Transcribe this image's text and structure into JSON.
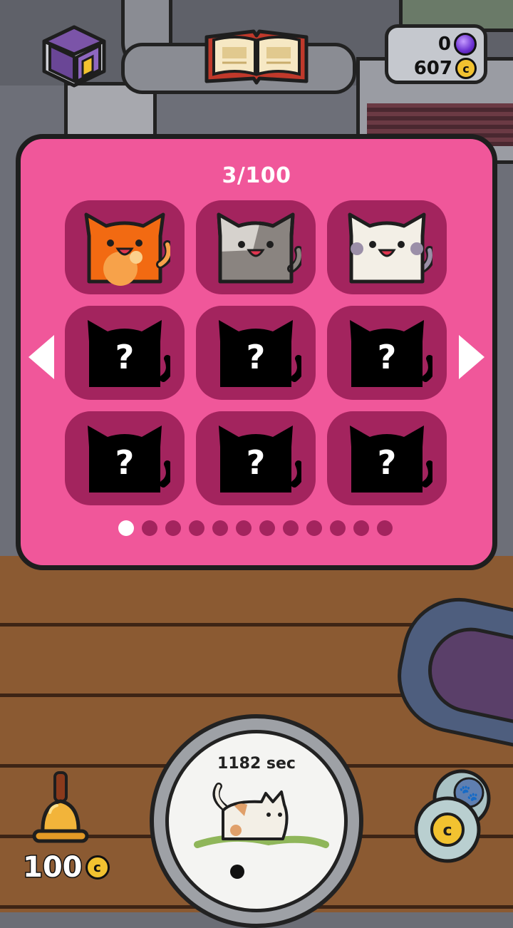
{
  "hud": {
    "gems": "0",
    "coins": "607",
    "coin_symbol": "c"
  },
  "collection": {
    "counter": "3/100",
    "current_page": 1,
    "total_pages": 12,
    "cells": [
      {
        "status": "unlocked",
        "color": "orange"
      },
      {
        "status": "unlocked",
        "color": "gray"
      },
      {
        "status": "unlocked",
        "color": "white"
      },
      {
        "status": "locked",
        "symbol": "?"
      },
      {
        "status": "locked",
        "symbol": "?"
      },
      {
        "status": "locked",
        "symbol": "?"
      },
      {
        "status": "locked",
        "symbol": "?"
      },
      {
        "status": "locked",
        "symbol": "?"
      },
      {
        "status": "locked",
        "symbol": "?"
      }
    ]
  },
  "bottom": {
    "bell_price": "100",
    "coin_symbol": "c",
    "timer": "1182 sec"
  },
  "colors": {
    "panel": "#f0579a",
    "cell": "#a3245e",
    "outline": "#1e1e1e"
  }
}
